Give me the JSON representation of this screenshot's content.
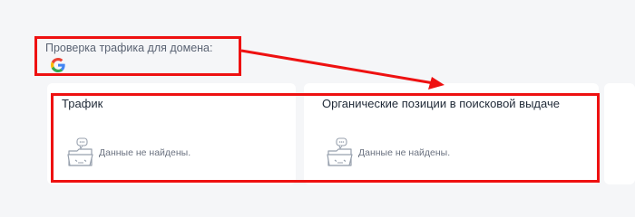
{
  "header": {
    "label": "Проверка трафика для домена:",
    "provider_icon": "google-g-icon"
  },
  "cards": [
    {
      "title": "Трафик",
      "empty_icon": "empty-folder-icon",
      "empty_text": "Данные не найдены."
    },
    {
      "title": "Органические позиции в поисковой выдаче",
      "empty_icon": "empty-folder-icon",
      "empty_text": "Данные не найдены."
    }
  ],
  "colors": {
    "background": "#f5f6f8",
    "card": "#ffffff",
    "annotation": "#ee1111",
    "google_blue": "#4285F4",
    "google_red": "#EA4335",
    "google_yellow": "#FBBC05",
    "google_green": "#34A853"
  }
}
